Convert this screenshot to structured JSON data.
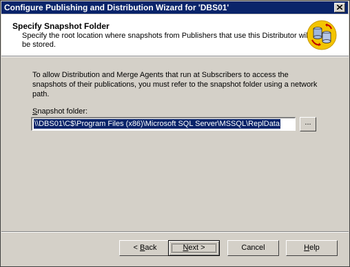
{
  "window": {
    "title": "Configure Publishing and Distribution Wizard for 'DBS01'"
  },
  "header": {
    "title": "Specify Snapshot Folder",
    "subtitle": "Specify the root location where snapshots from Publishers that use this Distributor will be stored.",
    "icon": "distribution-database-icon"
  },
  "body": {
    "intro": "To allow Distribution and Merge Agents that run at Subscribers to access the snapshots of their publications, you must refer to the snapshot folder using a network path.",
    "snapshot_label_prefix": "S",
    "snapshot_label_rest": "napshot folder:",
    "snapshot_value": "\\\\DBS01\\C$\\Program Files (x86)\\Microsoft SQL Server\\MSSQL\\ReplData",
    "browse_label": "..."
  },
  "buttons": {
    "back_pre": "< ",
    "back_u": "B",
    "back_post": "ack",
    "next_u": "N",
    "next_post": "ext >",
    "cancel": "Cancel",
    "help_u": "H",
    "help_post": "elp"
  }
}
